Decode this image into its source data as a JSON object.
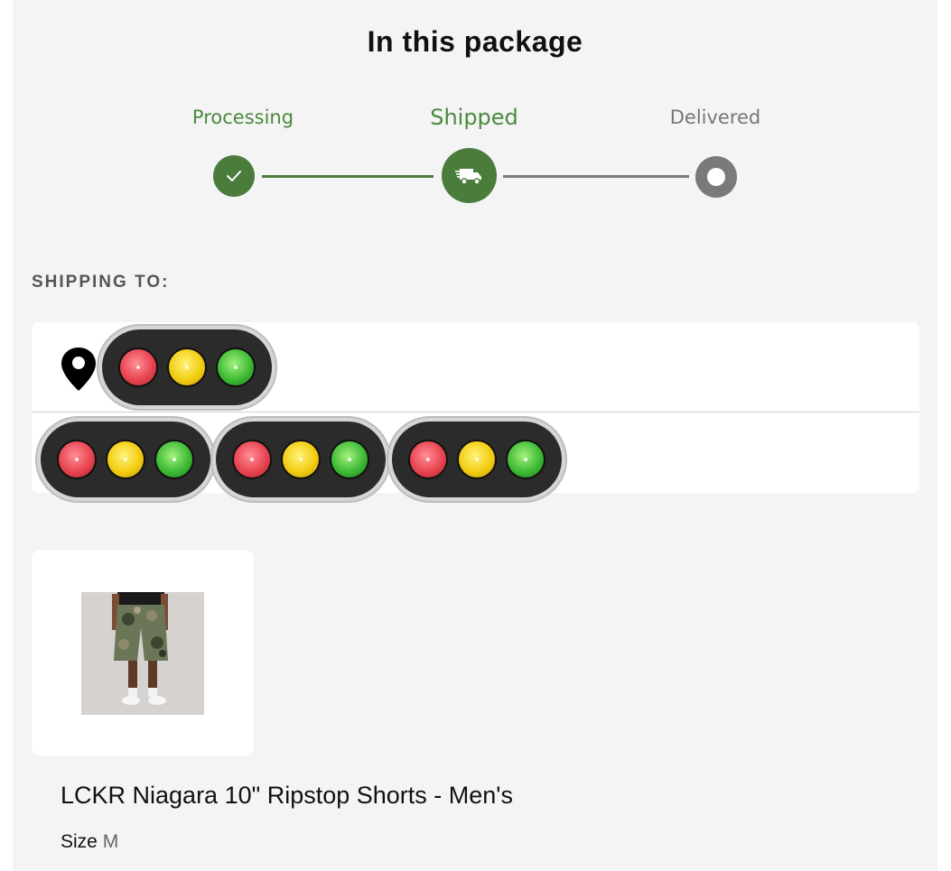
{
  "package": {
    "title": "In this package"
  },
  "tracker": {
    "steps": [
      {
        "label": "Processing",
        "state": "done",
        "icon": "check-icon"
      },
      {
        "label": "Shipped",
        "state": "current",
        "icon": "truck-icon"
      },
      {
        "label": "Delivered",
        "state": "pending",
        "icon": "circle-icon"
      }
    ],
    "colors": {
      "done": "#4a7c3c",
      "pending": "#7a7a7a"
    }
  },
  "shipping": {
    "heading": "SHIPPING TO:",
    "pin_icon": "location-pin-icon",
    "redaction_icon": "traffic-light-icon"
  },
  "product": {
    "name": "LCKR Niagara 10\" Ripstop Shorts - Men's",
    "size_label": "Size",
    "size_value": "M"
  }
}
